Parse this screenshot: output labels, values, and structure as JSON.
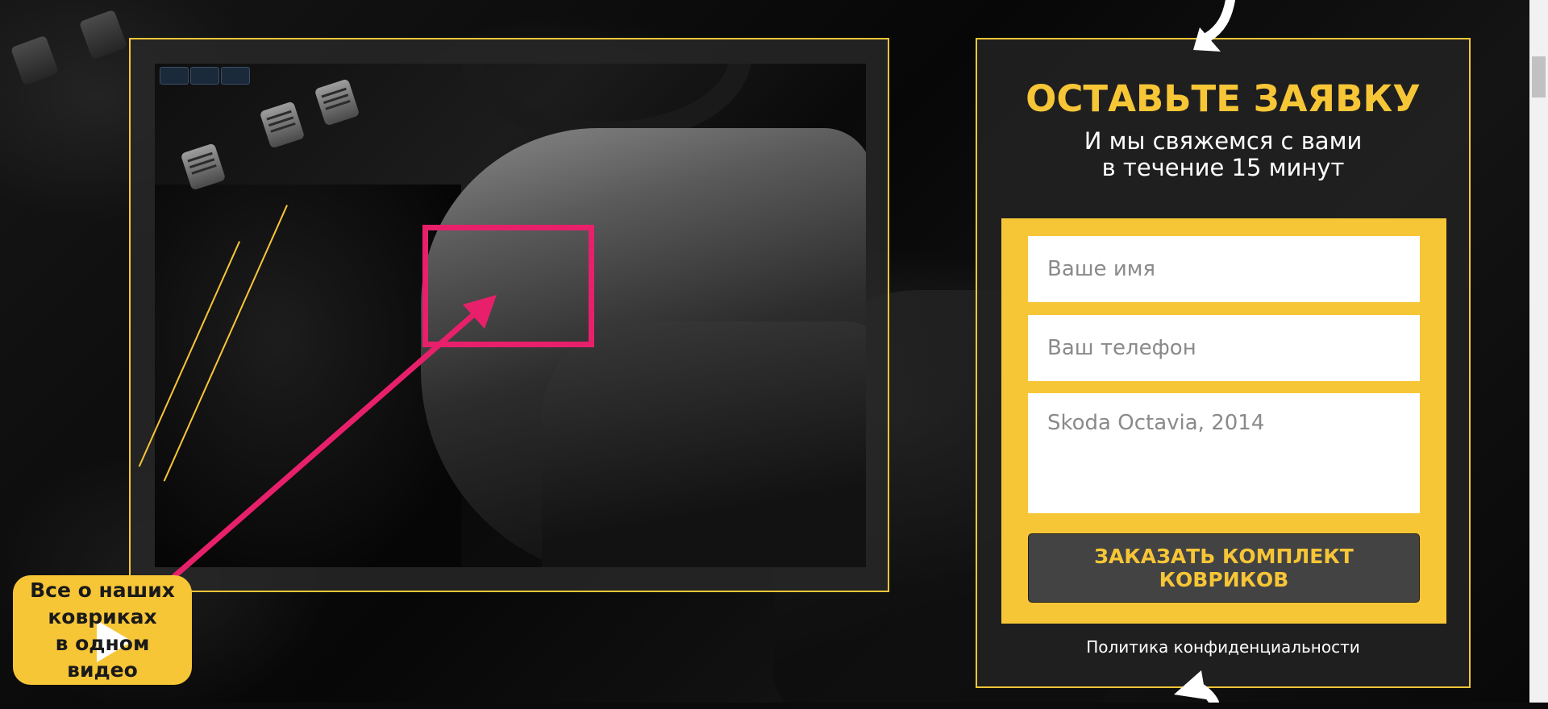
{
  "form": {
    "title": "ОСТАВЬТЕ ЗАЯВКУ",
    "subtitle": "И мы свяжемся с вами\nв течение 15 минут",
    "name_placeholder": "Ваше имя",
    "phone_placeholder": "Ваш телефон",
    "car_placeholder": "Skoda Octavia, 2014",
    "submit_label": "ЗАКАЗАТЬ КОМПЛЕКТ КОВРИКОВ",
    "privacy_label": "Политика конфиденциальности"
  },
  "video": {
    "badge_label": "Все о наших\nковриках\nв одном видео"
  },
  "colors": {
    "accent": "#f7c637",
    "highlight": "#e8206b",
    "button_bg": "#434343"
  }
}
